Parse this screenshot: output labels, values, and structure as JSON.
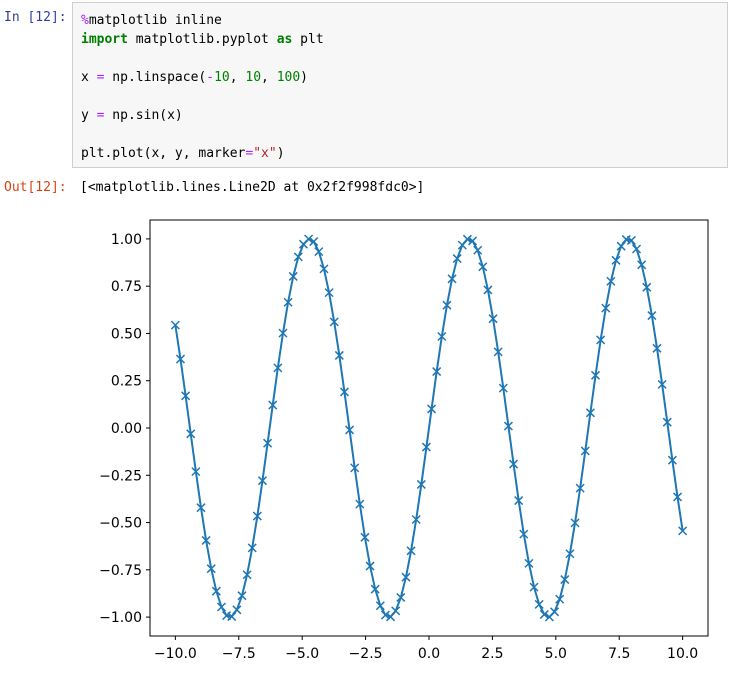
{
  "input_cell": {
    "prompt": "In [12]:",
    "lines": [
      {
        "parts": [
          {
            "t": "%",
            "c": "magic"
          },
          {
            "t": "matplotlib inline",
            "c": "plain"
          }
        ]
      },
      {
        "parts": [
          {
            "t": "import",
            "c": "kw"
          },
          {
            "t": " matplotlib.pyplot ",
            "c": "plain"
          },
          {
            "t": "as",
            "c": "kw"
          },
          {
            "t": " plt",
            "c": "plain"
          }
        ]
      },
      {
        "parts": []
      },
      {
        "parts": [
          {
            "t": "x ",
            "c": "plain"
          },
          {
            "t": "=",
            "c": "op"
          },
          {
            "t": " np.linspace(",
            "c": "plain"
          },
          {
            "t": "-",
            "c": "op"
          },
          {
            "t": "10",
            "c": "num"
          },
          {
            "t": ", ",
            "c": "plain"
          },
          {
            "t": "10",
            "c": "num"
          },
          {
            "t": ", ",
            "c": "plain"
          },
          {
            "t": "100",
            "c": "num"
          },
          {
            "t": ")",
            "c": "plain"
          }
        ]
      },
      {
        "parts": []
      },
      {
        "parts": [
          {
            "t": "y ",
            "c": "plain"
          },
          {
            "t": "=",
            "c": "op"
          },
          {
            "t": " np.sin(x)",
            "c": "plain"
          }
        ]
      },
      {
        "parts": []
      },
      {
        "parts": [
          {
            "t": "plt.plot(x, y, marker",
            "c": "plain"
          },
          {
            "t": "=",
            "c": "op"
          },
          {
            "t": "\"x\"",
            "c": "str"
          },
          {
            "t": ")",
            "c": "plain"
          }
        ]
      }
    ]
  },
  "output_cell": {
    "prompt": "Out[12]:",
    "text": "[<matplotlib.lines.Line2D at 0x2f2f998fdc0>]"
  },
  "colors": {
    "series": "#1f77b4"
  },
  "chart_data": {
    "type": "line",
    "title": "",
    "xlabel": "",
    "ylabel": "",
    "marker": "x",
    "x_function": "linspace(-10, 10, 100)",
    "y_function": "sin(x)",
    "xlim": [
      -11.0,
      11.0
    ],
    "ylim": [
      -1.1,
      1.1
    ],
    "x_ticks": [
      -10.0,
      -7.5,
      -5.0,
      -2.5,
      0.0,
      2.5,
      5.0,
      7.5,
      10.0
    ],
    "x_tick_labels": [
      "−10.0",
      "−7.5",
      "−5.0",
      "−2.5",
      "0.0",
      "2.5",
      "5.0",
      "7.5",
      "10.0"
    ],
    "y_ticks": [
      1.0,
      0.75,
      0.5,
      0.25,
      0.0,
      -0.25,
      -0.5,
      -0.75,
      -1.0
    ],
    "y_tick_labels": [
      "1.00",
      "0.75",
      "0.50",
      "0.25",
      "0.00",
      "−0.25",
      "−0.50",
      "−0.75",
      "−1.00"
    ],
    "series": [
      {
        "color": "#1f77b4"
      }
    ]
  }
}
